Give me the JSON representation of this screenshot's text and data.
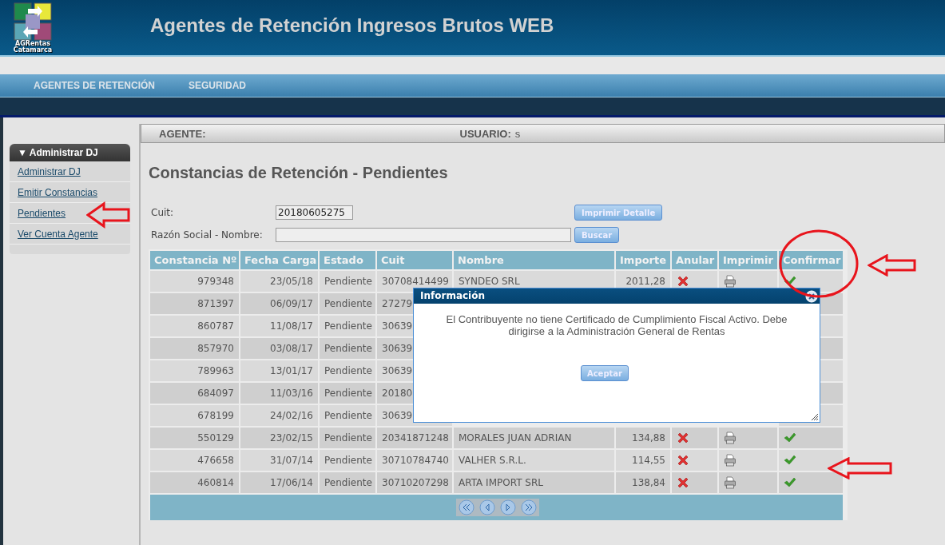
{
  "header": {
    "logo_lines": [
      "AGRentas",
      "Catamarca"
    ],
    "title": "Agentes de Retención Ingresos Brutos WEB"
  },
  "nav": [
    {
      "label": "AGENTES DE RETENCIÓN"
    },
    {
      "label": "SEGURIDAD"
    }
  ],
  "sidebar": {
    "title": "▼ Administrar DJ",
    "items": [
      {
        "label": "Administrar DJ"
      },
      {
        "label": "Emitir Constancias"
      },
      {
        "label": "Pendientes"
      },
      {
        "label": "Ver Cuenta Agente"
      }
    ]
  },
  "info_bar": {
    "agente_label": "AGENTE:",
    "usuario_label": "USUARIO:",
    "usuario_value": "s"
  },
  "page_title": "Constancias de Retención - Pendientes",
  "form": {
    "cuit_label": "Cuit:",
    "cuit_value": "20180605275",
    "name_label": "Razón Social - Nombre:",
    "print_button": "Imprimir Detalle",
    "search_button": "Buscar"
  },
  "table": {
    "columns": [
      "Constancia Nº",
      "Fecha Carga",
      "Estado",
      "Cuit",
      "Nombre",
      "Importe",
      "Anular",
      "Imprimir",
      "Confirmar"
    ],
    "rows": [
      {
        "constancia": "979348",
        "fecha": "23/05/18",
        "estado": "Pendiente",
        "cuit": "30708414499",
        "nombre": "SYNDEO SRL",
        "importe": "2011,28"
      },
      {
        "constancia": "871397",
        "fecha": "06/09/17",
        "estado": "Pendiente",
        "cuit": "27279"
      },
      {
        "constancia": "860787",
        "fecha": "11/08/17",
        "estado": "Pendiente",
        "cuit": "30639"
      },
      {
        "constancia": "857970",
        "fecha": "03/08/17",
        "estado": "Pendiente",
        "cuit": "30639"
      },
      {
        "constancia": "789963",
        "fecha": "13/01/17",
        "estado": "Pendiente",
        "cuit": "30639"
      },
      {
        "constancia": "684097",
        "fecha": "11/03/16",
        "estado": "Pendiente",
        "cuit": "20180"
      },
      {
        "constancia": "678199",
        "fecha": "24/02/16",
        "estado": "Pendiente",
        "cuit": "30639"
      },
      {
        "constancia": "550129",
        "fecha": "23/02/15",
        "estado": "Pendiente",
        "cuit": "20341871248",
        "nombre": "MORALES JUAN ADRIAN",
        "importe": "134,88"
      },
      {
        "constancia": "476658",
        "fecha": "31/07/14",
        "estado": "Pendiente",
        "cuit": "30710784740",
        "nombre": "VALHER S.R.L.",
        "importe": "114,55"
      },
      {
        "constancia": "460814",
        "fecha": "17/06/14",
        "estado": "Pendiente",
        "cuit": "30710207298",
        "nombre": "ARTA IMPORT SRL",
        "importe": "138,84"
      }
    ]
  },
  "dialog": {
    "title": "Información",
    "message": "El Contribuyente no tiene Certificado de Cumplimiento Fiscal Activo. Debe dirigirse a la Administración General de Rentas",
    "button": "Aceptar"
  }
}
